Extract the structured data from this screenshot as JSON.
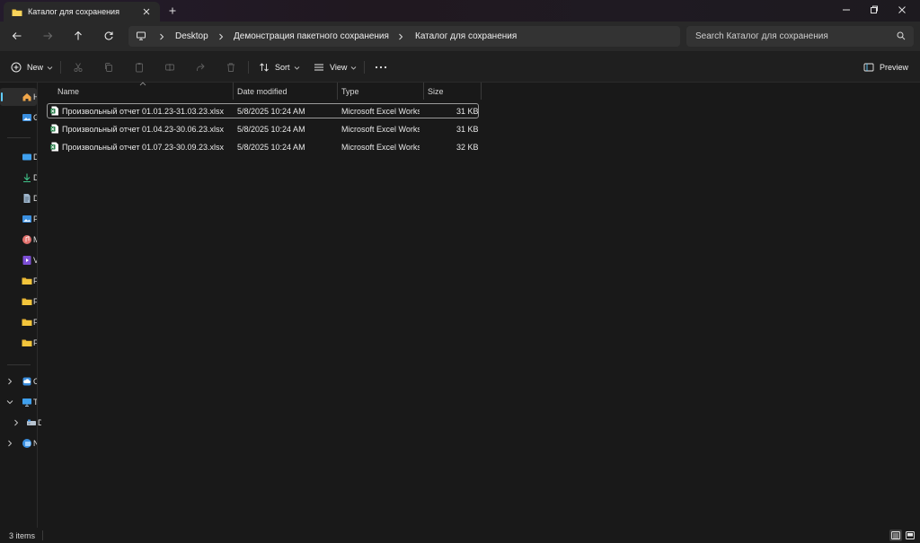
{
  "window": {
    "tab_title": "Каталог для сохранения",
    "icons": {
      "folder": "folder-icon",
      "close": "close-icon",
      "new_tab": "plus-icon",
      "minimize": "minimize-icon",
      "restore": "restore-icon"
    }
  },
  "address_bar": {
    "breadcrumbs": [
      "Desktop",
      "Демонстрация пакетного сохранения",
      "Каталог для сохранения"
    ],
    "search_placeholder": "Search Каталог для сохранения"
  },
  "command_bar": {
    "new_label": "New",
    "sort_label": "Sort",
    "view_label": "View",
    "preview_label": "Preview"
  },
  "nav_pane": {
    "items": [
      {
        "label": "Home",
        "icon": "home-icon"
      },
      {
        "label": "Gallery",
        "icon": "gallery-icon"
      },
      {
        "label": "Desktop",
        "icon": "desktop-icon"
      },
      {
        "label": "Downloads",
        "icon": "downloads-icon"
      },
      {
        "label": "Documents",
        "icon": "documents-icon"
      },
      {
        "label": "Pictures",
        "icon": "pictures-icon"
      },
      {
        "label": "Music",
        "icon": "music-icon"
      },
      {
        "label": "Videos",
        "icon": "videos-icon"
      },
      {
        "label": "Folder",
        "icon": "folder-icon"
      },
      {
        "label": "Folder",
        "icon": "folder-icon"
      },
      {
        "label": "Folder",
        "icon": "folder-icon"
      },
      {
        "label": "Folder",
        "icon": "folder-icon"
      },
      {
        "label": "OneDrive",
        "icon": "cloud-icon"
      },
      {
        "label": "This PC",
        "icon": "computer-icon"
      },
      {
        "label": "Drive",
        "icon": "drive-icon"
      },
      {
        "label": "Network",
        "icon": "network-icon"
      }
    ]
  },
  "file_list": {
    "columns": {
      "name": "Name",
      "date": "Date modified",
      "type": "Type",
      "size": "Size"
    },
    "rows": [
      {
        "name": "Произвольный отчет 01.01.23-31.03.23.xlsx",
        "date": "5/8/2025 10:24 AM",
        "type": "Microsoft Excel Worksheet",
        "size": "31 KB"
      },
      {
        "name": "Произвольный отчет 01.04.23-30.06.23.xlsx",
        "date": "5/8/2025 10:24 AM",
        "type": "Microsoft Excel Worksheet",
        "size": "31 KB"
      },
      {
        "name": "Произвольный отчет 01.07.23-30.09.23.xlsx",
        "date": "5/8/2025 10:24 AM",
        "type": "Microsoft Excel Worksheet",
        "size": "32 KB"
      }
    ]
  },
  "status_bar": {
    "item_count": "3 items"
  },
  "colors": {
    "accent": "#60cdff",
    "excel_green": "#1f7a43",
    "folder_yellow": "#f3c53c"
  }
}
